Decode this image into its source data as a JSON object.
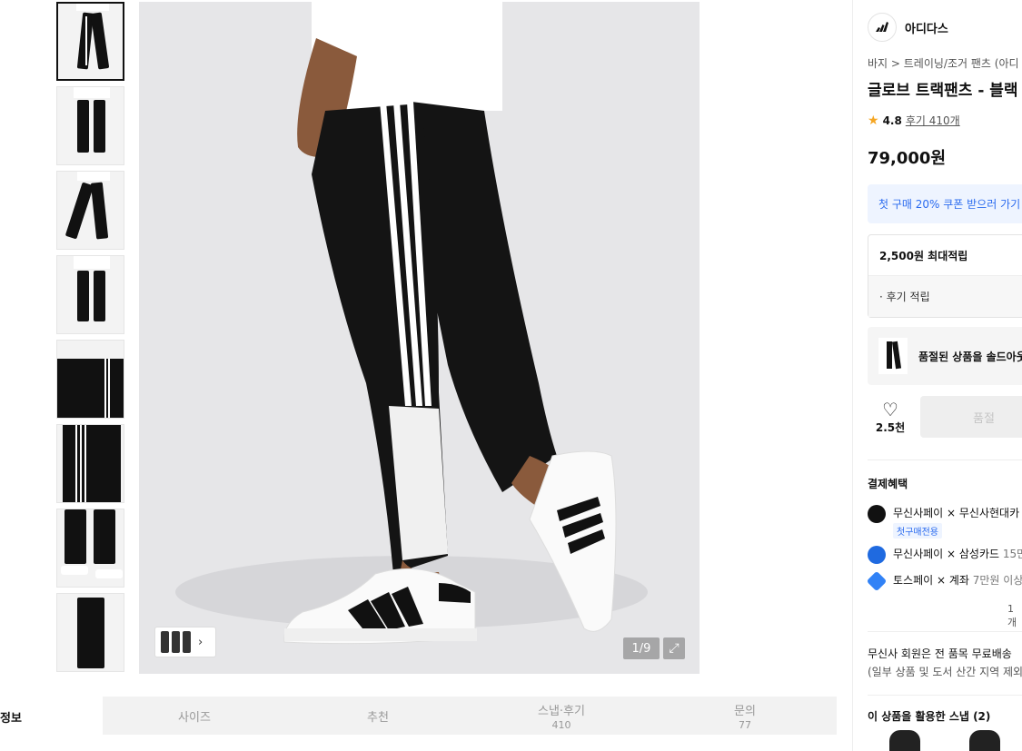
{
  "gallery": {
    "counter": "1/9",
    "thumbnail_count": 8
  },
  "tabs": {
    "info_label": "정보",
    "items": [
      {
        "label": "사이즈",
        "sub": ""
      },
      {
        "label": "추천",
        "sub": ""
      },
      {
        "label": "스냅·후기",
        "sub": "410"
      },
      {
        "label": "문의",
        "sub": "77"
      }
    ]
  },
  "product": {
    "brand": "아디다스",
    "breadcrumb": "바지 > 트레이닝/조거 팬츠 (아디",
    "title": "글로브 트랙팬츠 - 블랙",
    "rating": "4.8",
    "reviews": "후기 410개",
    "price": "79,000원"
  },
  "coupon": {
    "label": "첫 구매 20% 쿠폰 받으러 가기"
  },
  "points": {
    "max": "2,500원 최대적립",
    "review": "· 후기 적립"
  },
  "soldout": {
    "label": "품절된 상품을 솔드아웃"
  },
  "actions": {
    "like_count": "2.5천",
    "buy_label": "품절"
  },
  "benefits": {
    "title": "결제혜택",
    "items": [
      {
        "label": "무신사페이 × 무신사현대카",
        "tag": "첫구매전용",
        "color": "#111111"
      },
      {
        "label": "무신사페이 × 삼성카드",
        "extra": " 15만",
        "color": "#1f6ae0"
      },
      {
        "label": "토스페이 × 계좌",
        "extra": " 7만원 이상",
        "color": "#3182f6"
      }
    ],
    "count": "1개"
  },
  "shipping": {
    "line1": "무신사 회원은 전 품목 무료배송",
    "line2": "(일부 상품 및 도서 산간 지역 제외"
  },
  "snap": {
    "title": "이 상품을 활용한 스냅 (2)"
  }
}
